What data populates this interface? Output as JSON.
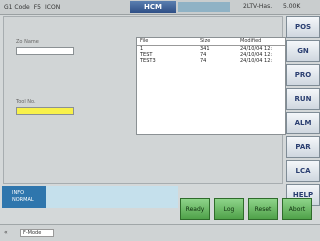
{
  "topbar": {
    "gcode": "G1 Code",
    "fn": "F5",
    "mode": "ICON",
    "badge": "HCM",
    "status": "2LTV-Has.",
    "right": "5.00K"
  },
  "sidemenu": [
    "POS",
    "GN",
    "PRO",
    "RUN",
    "ALM",
    "PAR",
    "LCA",
    "HELP"
  ],
  "left_labels": [
    "Zo Name",
    "Tool No."
  ],
  "list": {
    "headers": [
      "File",
      "Size",
      "Modified"
    ],
    "rows": [
      {
        "name": "1",
        "size": "341",
        "mod": "24/10/04 12:"
      },
      {
        "name": "TEST",
        "size": "74",
        "mod": "24/10/04 12:"
      },
      {
        "name": "TEST3",
        "size": "74",
        "mod": "24/10/04 12:"
      }
    ]
  },
  "message": [
    "INFO",
    "NORMAL"
  ],
  "buttons": [
    "Ready",
    "Log",
    "Reset",
    "Abort"
  ],
  "bottom": {
    "mark": "«",
    "item": "F-Mode"
  }
}
